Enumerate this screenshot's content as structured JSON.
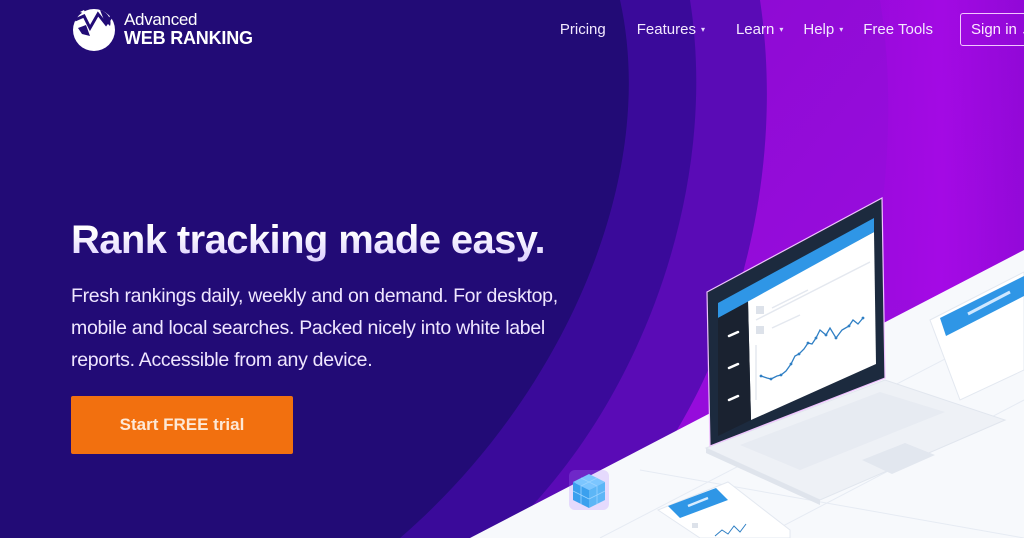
{
  "brand": {
    "name_line1": "Advanced",
    "name_line2": "WEB RANKING",
    "logo_icon": "globe-chart-icon"
  },
  "nav": {
    "items": [
      {
        "label": "Pricing",
        "has_dropdown": false
      },
      {
        "label": "Features",
        "has_dropdown": true
      },
      {
        "label": "Learn",
        "has_dropdown": true
      },
      {
        "label": "Help",
        "has_dropdown": true
      },
      {
        "label": "Free Tools",
        "has_dropdown": false
      }
    ],
    "dropdown_glyph": "▾",
    "signin_label": "Sign in",
    "signin_icon": "↗"
  },
  "hero": {
    "headline": "Rank tracking made easy.",
    "subtitle": "Fresh rankings daily, weekly and on demand. For desktop, mobile and local searches. Packed nicely into white label reports. Accessible from any device.",
    "cta_label": "Start FREE trial"
  },
  "colors": {
    "background_dark": "#220b76",
    "accent_purple": "#a107e0",
    "cta_orange": "#f2700f",
    "screen_blue": "#2f96e6"
  }
}
